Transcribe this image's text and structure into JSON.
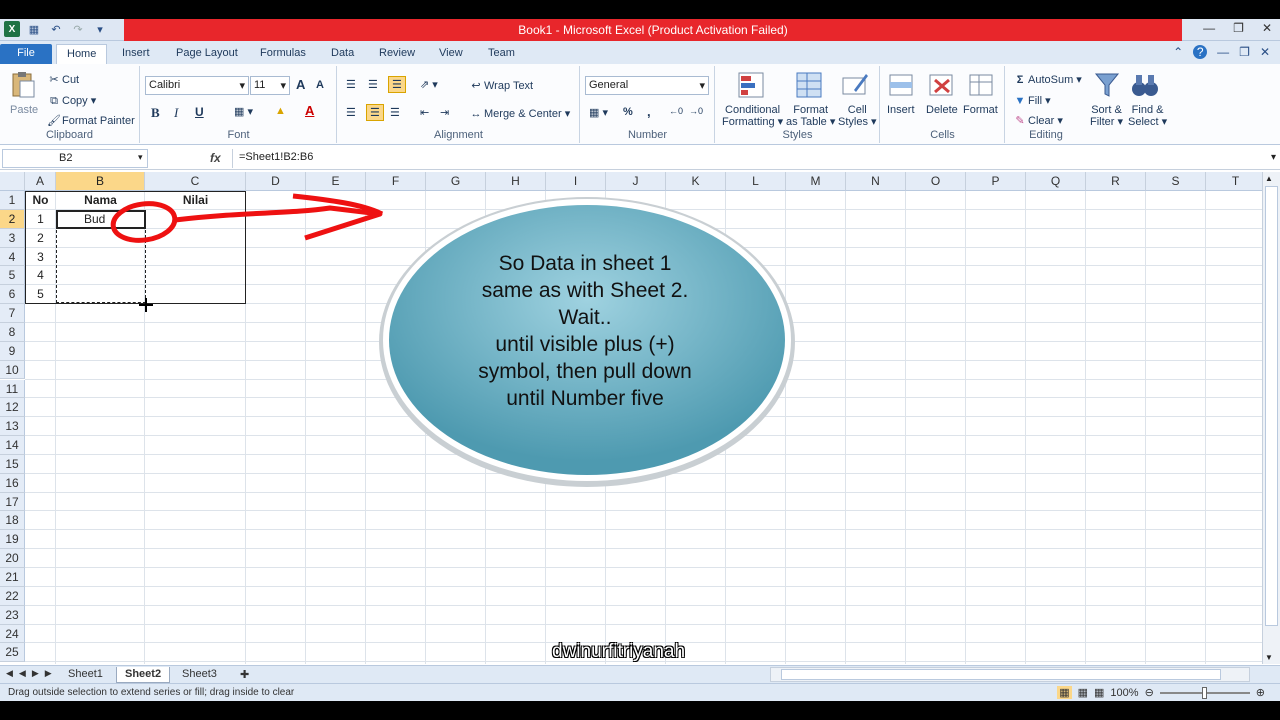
{
  "window": {
    "title": "Book1  -  Microsoft Excel (Product Activation Failed)"
  },
  "tabs": [
    {
      "label": "File"
    },
    {
      "label": "Home"
    },
    {
      "label": "Insert"
    },
    {
      "label": "Page Layout"
    },
    {
      "label": "Formulas"
    },
    {
      "label": "Data"
    },
    {
      "label": "Review"
    },
    {
      "label": "View"
    },
    {
      "label": "Team"
    }
  ],
  "ribbon": {
    "clipboard": {
      "paste": "Paste",
      "cut": "Cut",
      "copy": "Copy",
      "format_painter": "Format Painter",
      "label": "Clipboard"
    },
    "font": {
      "name": "Calibri",
      "size": "11",
      "label": "Font",
      "bold": "B",
      "italic": "I",
      "underline": "U",
      "grow": "A",
      "shrink": "A"
    },
    "alignment": {
      "wrap_text": "Wrap Text",
      "merge_center": "Merge & Center",
      "label": "Alignment"
    },
    "number": {
      "format": "General",
      "percent": "%",
      "comma": ",",
      "label": "Number"
    },
    "styles": {
      "conditional": "Conditional",
      "conditional2": "Formatting",
      "format_table": "Format",
      "format_table2": "as Table",
      "cell_styles": "Cell",
      "cell_styles2": "Styles",
      "label": "Styles"
    },
    "cells": {
      "insert": "Insert",
      "delete": "Delete",
      "format": "Format",
      "label": "Cells"
    },
    "editing": {
      "autosum": "AutoSum",
      "fill": "Fill",
      "clear": "Clear",
      "sort": "Sort &",
      "sort2": "Filter",
      "find": "Find &",
      "find2": "Select",
      "label": "Editing"
    }
  },
  "formula_bar": {
    "name_box": "B2",
    "fx": "fx",
    "formula": "=Sheet1!B2:B6"
  },
  "columns": [
    "A",
    "B",
    "C",
    "D",
    "E",
    "F",
    "G",
    "H",
    "I",
    "J",
    "K",
    "L",
    "M",
    "N",
    "O",
    "P",
    "Q",
    "R",
    "S",
    "T"
  ],
  "rows": [
    "1",
    "2",
    "3",
    "4",
    "5",
    "6",
    "7",
    "8",
    "9",
    "10",
    "11",
    "12",
    "13",
    "14",
    "15",
    "16",
    "17",
    "18",
    "19",
    "20",
    "21",
    "22",
    "23",
    "24",
    "25"
  ],
  "table": {
    "header": {
      "no": "No",
      "nama": "Nama",
      "nilai": "Nilai"
    },
    "numbers": [
      "1",
      "2",
      "3",
      "4",
      "5"
    ],
    "cell_b2": "Bud"
  },
  "callout": {
    "lines": [
      "So Data in sheet 1",
      "same as with Sheet 2.",
      "Wait..",
      "until visible plus (+)",
      "symbol, then pull down",
      "until Number five"
    ]
  },
  "sheets": [
    {
      "label": "Sheet1"
    },
    {
      "label": "Sheet2"
    },
    {
      "label": "Sheet3"
    }
  ],
  "status": {
    "text": "Drag outside selection to extend series or fill; drag inside to clear",
    "zoom": "100%"
  },
  "watermark": "dwinurfitriyanah",
  "colors": {
    "accent": "#2a72c4",
    "title_band": "#e8262b",
    "header_highlight": "#fbd789",
    "callout_fill": "#5aa8bd"
  }
}
